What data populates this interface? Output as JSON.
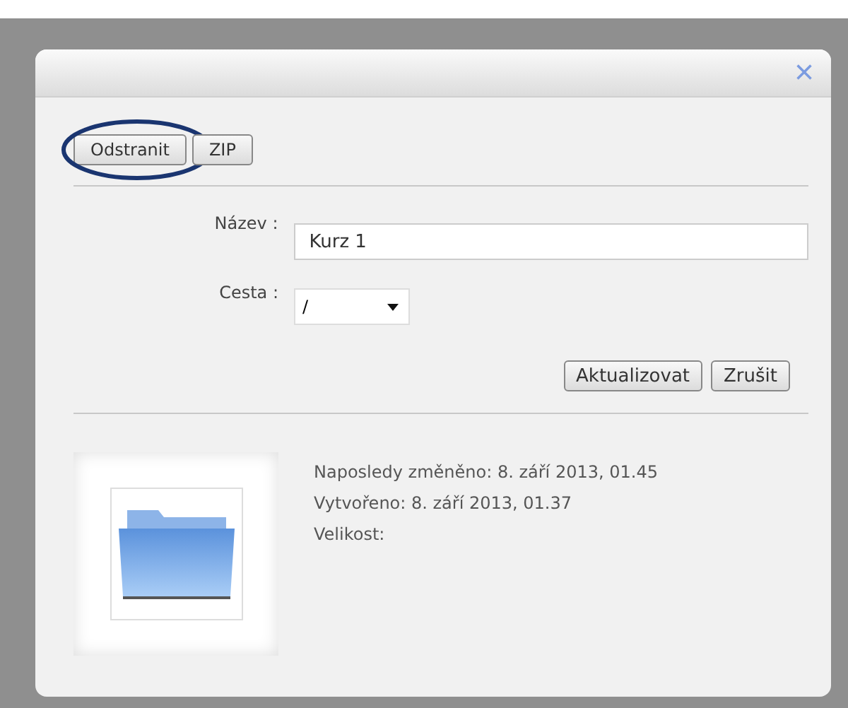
{
  "dialog": {
    "close": "×",
    "toolbar": [
      {
        "label": "Odstranit",
        "highlighted": true
      },
      {
        "label": "ZIP",
        "highlighted": false
      }
    ],
    "fields": [
      {
        "kind": "text",
        "label": "Název :",
        "value": "Kurz 1"
      },
      {
        "kind": "select",
        "label": "Cesta :",
        "value": "/"
      }
    ],
    "actions": [
      "Aktualizovat",
      "Zrušit"
    ],
    "details": [
      "Naposledy změněno: 8. září 2013, 01.45",
      "Vytvořeno: 8. září 2013, 01.37",
      "Velikost:"
    ]
  }
}
